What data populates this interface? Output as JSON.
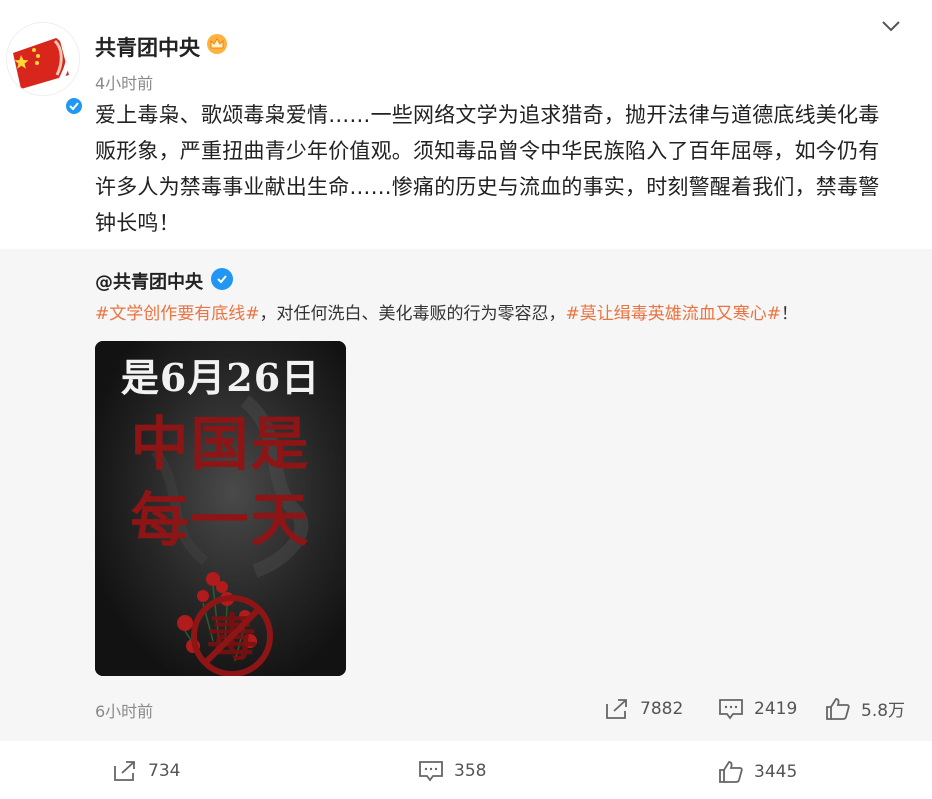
{
  "post": {
    "username": "共青团中央",
    "timestamp": "4小时前",
    "text": "爱上毒枭、歌颂毒枭爱情……一些网络文学为追求猎奇，抛开法律与道德底线美化毒贩形象，严重扭曲青少年价值观。须知毒品曾令中华民族陷入了百年屈辱，如今仍有许多人为禁毒事业献出生命……惨痛的历史与流血的事实，时刻警醒着我们，禁毒警钟长鸣！"
  },
  "repost": {
    "username": "@共青团中央",
    "hashtag1": "#文学创作要有底线#",
    "middle_text": "，对任何洗白、美化毒贩的行为零容忍，",
    "hashtag2": "#莫让缉毒英雄流血又寒心#",
    "end_text": "！",
    "poster": {
      "line1": "是6月26日",
      "line2": "中国是",
      "line3": "每一天",
      "seal_char": "毒"
    },
    "timestamp": "6小时前",
    "stats": {
      "share": "7882",
      "comment": "2419",
      "like": "5.8万"
    }
  },
  "actions": {
    "share": "734",
    "comment": "358",
    "like": "3445"
  },
  "colors": {
    "hashtag": "#eb7340",
    "verified": "#2196f3",
    "poster_red": "#8e1515"
  }
}
